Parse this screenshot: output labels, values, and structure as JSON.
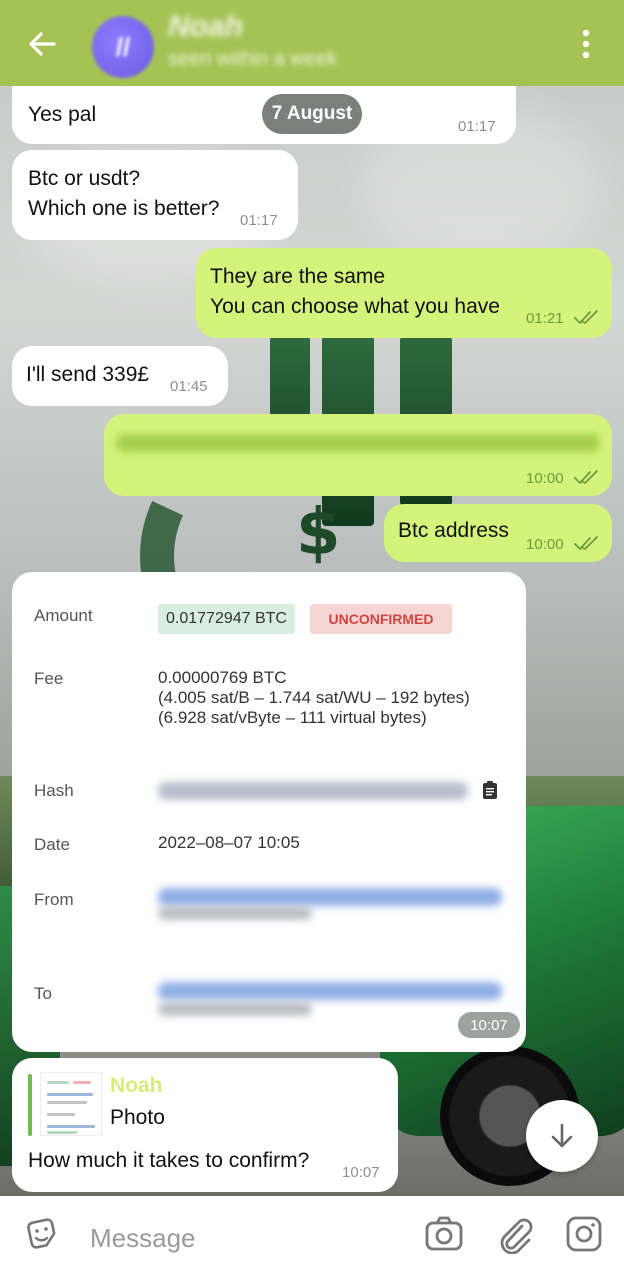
{
  "header": {
    "contact_name": "Noah",
    "status": "seen within a week",
    "avatar_initials": "//"
  },
  "date_separator": "7 August",
  "messages": [
    {
      "dir": "in",
      "text": "Yes pal",
      "time": "01:17"
    },
    {
      "dir": "in",
      "text": "Btc or usdt?\nWhich one is better?",
      "time": "01:17"
    },
    {
      "dir": "out",
      "text": "They are the same\nYou can choose what you have",
      "time": "01:21"
    },
    {
      "dir": "in",
      "text": "I'll send 339£",
      "time": "01:45"
    },
    {
      "dir": "out",
      "text": "",
      "time": "10:00"
    },
    {
      "dir": "out",
      "text": "Btc address",
      "time": "10:00"
    }
  ],
  "transaction": {
    "labels": {
      "amount": "Amount",
      "fee": "Fee",
      "hash": "Hash",
      "date": "Date",
      "from": "From",
      "to": "To"
    },
    "amount": "0.01772947 BTC",
    "status": "UNCONFIRMED",
    "fee_line1": "0.00000769 BTC",
    "fee_line2": "(4.005 sat/B – 1.744 sat/WU – 192 bytes)",
    "fee_line3": "(6.928 sat/vByte – 111 virtual bytes)",
    "date": "2022–08–07 10:05",
    "time": "10:07"
  },
  "reply_message": {
    "reply_to_name": "Noah",
    "reply_to_kind": "Photo",
    "text": "How much it takes to confirm?",
    "time": "10:07"
  },
  "input": {
    "placeholder": "Message"
  },
  "colors": {
    "header": "#a5c355",
    "outgoing_bubble": "#d4f37a",
    "incoming_bubble": "#ffffff",
    "unconfirmed": "#d0453f"
  },
  "icons": [
    "back-arrow-icon",
    "kebab-menu-icon",
    "sticker-icon",
    "camera-icon",
    "attach-icon",
    "instagram-icon",
    "chevron-down-icon",
    "clipboard-icon",
    "double-check-icon"
  ]
}
